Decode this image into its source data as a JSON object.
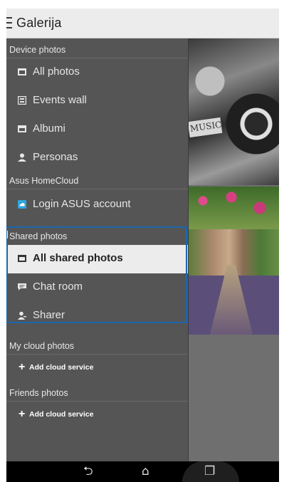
{
  "app": {
    "title": "Galerija"
  },
  "drawer": {
    "device_photos": {
      "header": "Device photos",
      "items": [
        {
          "label": "All photos",
          "icon": "photos-icon"
        },
        {
          "label": "Events wall",
          "icon": "events-wall-icon"
        },
        {
          "label": "Albumi",
          "icon": "album-icon"
        },
        {
          "label": "Personas",
          "icon": "person-icon"
        }
      ]
    },
    "asus_homecloud": {
      "header": "Asus HomeCloud",
      "items": [
        {
          "label": "Login ASUS account",
          "icon": "asus-cloud-icon"
        }
      ]
    },
    "shared_photos": {
      "header": "Shared photos",
      "items": [
        {
          "label": "All shared photos",
          "icon": "shared-photos-icon",
          "selected": true
        },
        {
          "label": "Chat room",
          "icon": "chat-icon"
        },
        {
          "label": "Sharer",
          "icon": "sharer-icon"
        }
      ]
    },
    "my_cloud_photos": {
      "header": "My cloud photos",
      "add_label": "Add cloud service"
    },
    "friends_photos": {
      "header": "Friends photos",
      "add_label": "Add cloud service"
    }
  },
  "photo_labels": {
    "music": "MUSIC"
  },
  "navbar": {
    "back": "⮌",
    "home": "⌂",
    "recent": "❐"
  },
  "colors": {
    "highlight": "#1c66ad",
    "drawer_bg": "#555555",
    "selected_bg": "#ececec"
  }
}
